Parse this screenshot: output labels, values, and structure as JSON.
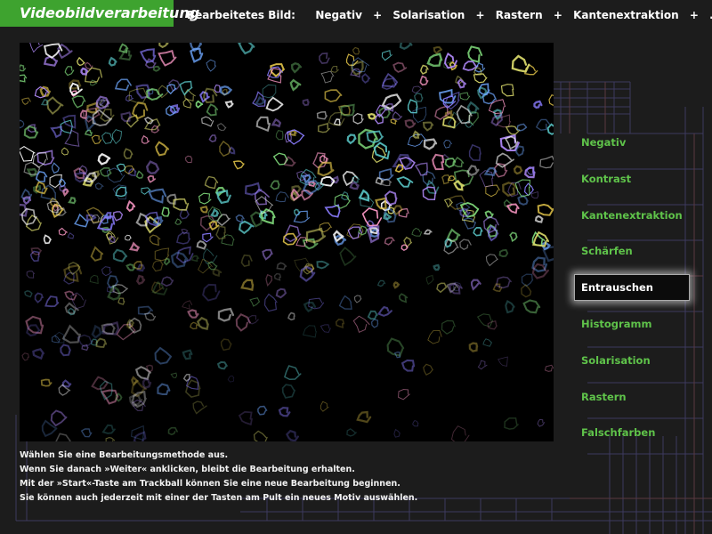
{
  "app": {
    "title": "Videobildverarbeitung"
  },
  "pipeline": {
    "label": "Bearbeitetes Bild:",
    "steps": [
      "Negativ",
      "Solarisation",
      "Rastern",
      "Kantenextraktion",
      "..."
    ],
    "separator": "+"
  },
  "menu": {
    "items": [
      {
        "label": "Negativ"
      },
      {
        "label": "Kontrast"
      },
      {
        "label": "Kantenextraktion"
      },
      {
        "label": "Schärfen"
      },
      {
        "label": "Entrauschen",
        "selected": true
      },
      {
        "label": "Histogramm"
      },
      {
        "label": "Solarisation"
      },
      {
        "label": "Rastern"
      },
      {
        "label": "Falschfarben"
      }
    ]
  },
  "instructions": {
    "lines": [
      "Wählen Sie eine Bearbeitungsmethode aus.",
      "Wenn Sie danach »Weiter« anklicken, bleibt die Bearbeitung erhalten.",
      "Mit der »Start«-Taste am Trackball können Sie eine neue Bearbeitung beginnen.",
      "Sie können auch jederzeit mit einer der Tasten am Pult ein neues Motiv auswählen."
    ]
  },
  "colors": {
    "accent_green": "#3ea32f",
    "menu_text": "#5fc34a",
    "background": "#1c1c1c"
  }
}
